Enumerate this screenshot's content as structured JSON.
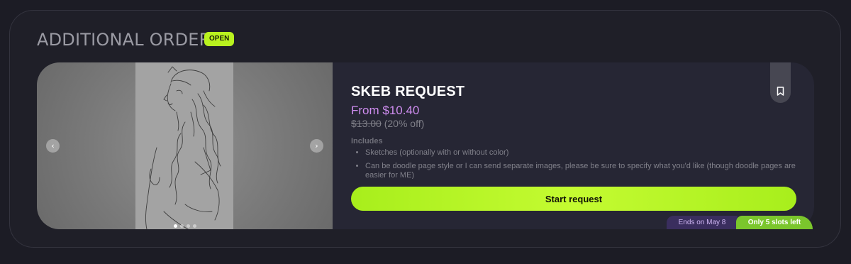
{
  "section": {
    "title": "ADDITIONAL ORDERS",
    "status_badge": "OPEN"
  },
  "gallery": {
    "prev_icon": "‹",
    "next_icon": "›",
    "image_count": 4,
    "active_index": 0
  },
  "product": {
    "title": "SKEB REQUEST",
    "price": "From $10.40",
    "original_price": "$13.00",
    "discount": "(20% off)",
    "includes_title": "Includes",
    "includes": [
      "Sketches (optionally with or without color)",
      "Can be doodle page style or I can send separate images, please be sure to specify what you'd like (though doodle pages are easier for ME)"
    ],
    "cta_label": "Start request",
    "ends_label": "Ends on May 8",
    "slots_label": "Only 5 slots left"
  },
  "icons": {
    "bookmark": "bookmark-icon",
    "prev": "chevron-left-icon",
    "next": "chevron-right-icon"
  },
  "colors": {
    "background": "#1c1c25",
    "card": "#262634",
    "accent_green": "#b9f21f",
    "price_purple": "#cf8df0",
    "ends_badge_bg": "#3a2e5e",
    "slots_badge_bg": "#7bc62c"
  }
}
